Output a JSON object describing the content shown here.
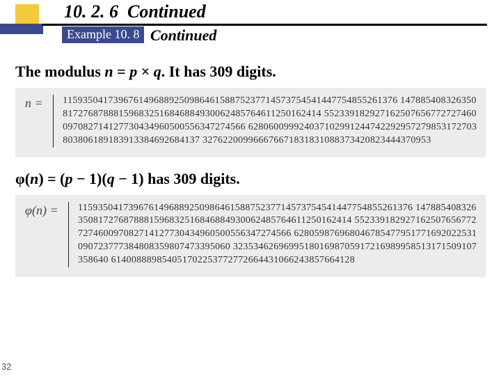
{
  "header": {
    "section_number": "10. 2. 6",
    "section_title_suffix": "Continued",
    "example_label": "Example 10. 8",
    "example_suffix": "Continued"
  },
  "modulus": {
    "sentence_prefix": "The modulus ",
    "formula_n": "n",
    "equals": " = ",
    "formula_p": "p",
    "times": " × ",
    "formula_q": "q",
    "sentence_suffix": ". It has 309 digits.",
    "label": "n =",
    "value": "115935041739676149688925098646158875237714573754541447754855261376 147885408326350817276878881596832516846884930062485764611250162414 552339182927162507656772727460097082714127730434960500556347274566 628060099924037102991244742292957279853172703803806189183913384692684137 327622009966676671831831088373420823444370953"
  },
  "phi": {
    "sentence_prefix": "φ(",
    "n": "n",
    "mid1": ") = (",
    "p": "p",
    "mid2": " − 1)(",
    "q": "q",
    "mid3": " − 1) has 309 digits.",
    "label": "φ(n) =",
    "value": "115935041739676149688925098646158875237714573754541447754855261376 147885408326350817276878881596832516846884930062485764611250162414 552339182927162507656772727460097082714127730434960500556347274566 628059876968046785477951771692022531090723777384808359807473395060 323534626969951801698705917216989958513171509107358640 614008889854051702253772772664431066243857664128"
  },
  "page_number": "32"
}
